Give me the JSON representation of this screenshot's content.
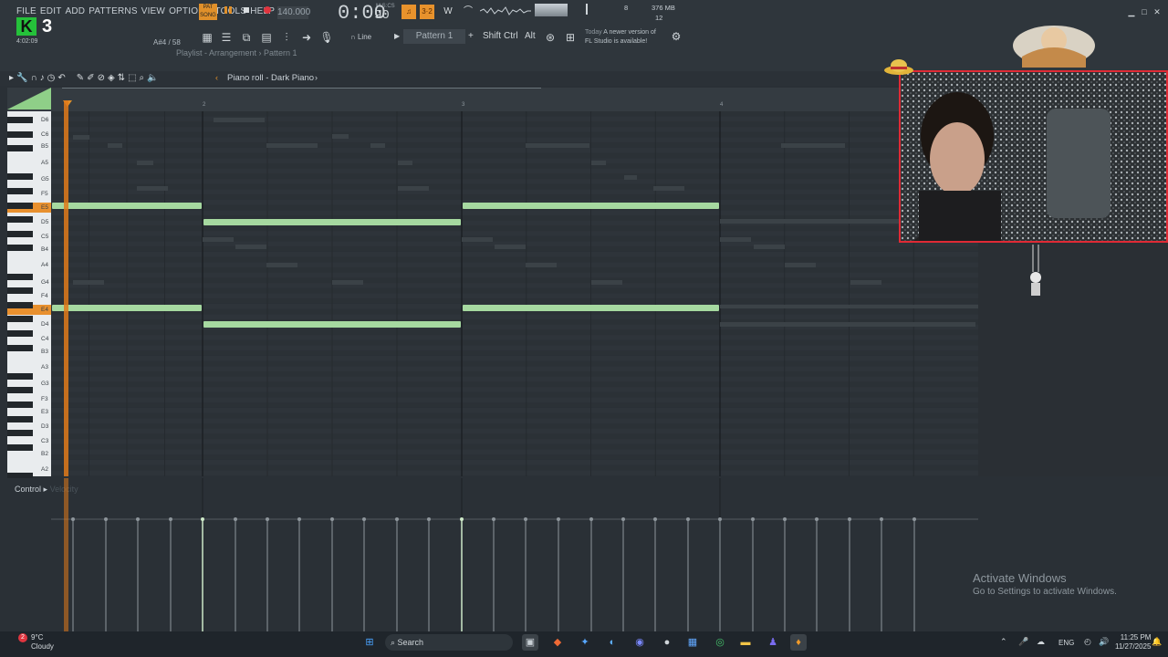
{
  "menu": [
    "FILE",
    "EDIT",
    "ADD",
    "PATTERNS",
    "VIEW",
    "OPTIONS",
    "TOOLS",
    "HELP"
  ],
  "logo": {
    "letter": "K",
    "number": "3",
    "time": "4:02:09"
  },
  "transport": {
    "pat_label": "PAT",
    "song_label": "SONG",
    "tempo": "140.000",
    "clock": "0:00",
    "clock_frac": "90",
    "clock_unit": "M:S:CS"
  },
  "hint": {
    "note": "A#4 / 58"
  },
  "memory": {
    "cpu": "8",
    "mem": "376 MB",
    "poly": "12"
  },
  "toolbar": {
    "snap": "Line",
    "pattern": "Pattern 1",
    "keys": [
      "Shift",
      "Ctrl",
      "Alt"
    ]
  },
  "news": {
    "when": "Today",
    "text1": "A newer version of",
    "text2": "FL Studio is available!"
  },
  "breadcrumb": "Playlist - Arrangement › Pattern 1",
  "piano_roll": {
    "title": "Piano roll - Dark Piano"
  },
  "bars": [
    "2",
    "3",
    "4"
  ],
  "keys": [
    "D6",
    "C6",
    "B5",
    "A5",
    "G5",
    "F5",
    "E5",
    "D5",
    "C5",
    "B4",
    "A4",
    "G4",
    "F4",
    "E4",
    "D4",
    "C4",
    "B3",
    "A3",
    "G3",
    "F3",
    "E3",
    "D3",
    "C3",
    "B2",
    "A2"
  ],
  "control": {
    "label": "Control",
    "sub": "Velocity"
  },
  "watermark": {
    "title": "Activate Windows",
    "sub": "Go to Settings to activate Windows."
  },
  "taskbar": {
    "weather_temp": "9°C",
    "weather_desc": "Cloudy",
    "badge": "2",
    "search": "Search",
    "lang": "ENG",
    "time": "11:25 PM",
    "date": "11/27/2025"
  },
  "colors": {
    "note": "#a6d9a0",
    "accent": "#e07a1a",
    "webcam_border": "#e02a35",
    "logo": "#25c13a"
  }
}
